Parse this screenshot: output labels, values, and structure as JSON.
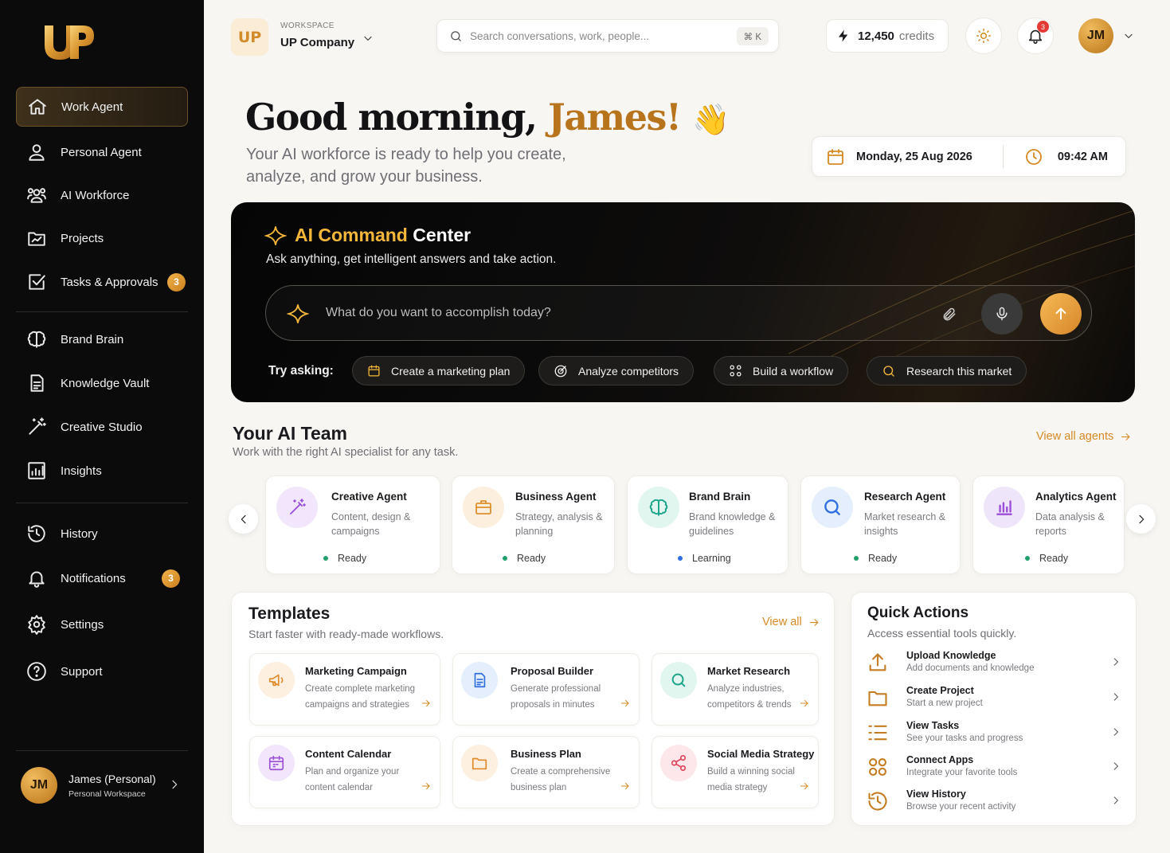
{
  "sidebar": {
    "logo_text": "UP",
    "items": [
      {
        "label": "Work Agent"
      },
      {
        "label": "Personal Agent"
      },
      {
        "label": "AI Workforce"
      },
      {
        "label": "Projects"
      },
      {
        "label": "Tasks & Approvals",
        "badge": "3"
      },
      {
        "label": "Brand Brain"
      },
      {
        "label": "Knowledge Vault"
      },
      {
        "label": "Creative Studio"
      },
      {
        "label": "Insights"
      },
      {
        "label": "History"
      },
      {
        "label": "Notifications",
        "badge": "3"
      },
      {
        "label": "Settings"
      },
      {
        "label": "Support"
      }
    ],
    "user": {
      "initials": "JM",
      "name": "James (Personal)",
      "workspace": "Personal Workspace"
    }
  },
  "header": {
    "workspace_logo": "UP",
    "workspace_label": "WORKSPACE",
    "workspace_name": "UP Company",
    "search_placeholder": "Search conversations, work, people...",
    "search_shortcut": "⌘ K",
    "credits_value": "12,450",
    "credits_label": "credits",
    "notification_count": "3",
    "avatar_initials": "JM"
  },
  "greeting": {
    "prefix": "Good morning, ",
    "name": "James!",
    "emoji": "👋",
    "subtitle": "Your AI workforce is ready to help you create, analyze, and grow your business.",
    "date": "Monday, 25 Aug 2026",
    "time": "09:42 AM"
  },
  "command_center": {
    "title_accent": "AI Command",
    "title_rest": " Center",
    "subtitle": "Ask anything, get intelligent answers and take action.",
    "input_placeholder": "What do you want to accomplish today?",
    "try_label": "Try asking:",
    "suggestions": [
      "Create a marketing plan",
      "Analyze competitors",
      "Build a workflow",
      "Research this market"
    ]
  },
  "ai_team": {
    "title": "Your AI Team",
    "subtitle": "Work with the right AI specialist for any task.",
    "view_all": "View all agents",
    "agents": [
      {
        "name": "Creative Agent",
        "desc": "Content, design & campaigns",
        "status": "Ready",
        "status_color": "#22a06b"
      },
      {
        "name": "Business Agent",
        "desc": "Strategy, analysis & planning",
        "status": "Ready",
        "status_color": "#22a06b"
      },
      {
        "name": "Brand Brain",
        "desc": "Brand knowledge & guidelines",
        "status": "Learning",
        "status_color": "#2f6fe0"
      },
      {
        "name": "Research Agent",
        "desc": "Market research & insights",
        "status": "Ready",
        "status_color": "#22a06b"
      },
      {
        "name": "Analytics Agent",
        "desc": "Data analysis & reports",
        "status": "Ready",
        "status_color": "#22a06b"
      }
    ]
  },
  "templates": {
    "title": "Templates",
    "subtitle": "Start faster with ready-made workflows.",
    "view_all": "View all",
    "items": [
      {
        "name": "Marketing Campaign",
        "desc": "Create complete marketing campaigns and strategies"
      },
      {
        "name": "Proposal Builder",
        "desc": "Generate professional proposals in minutes"
      },
      {
        "name": "Market Research",
        "desc": "Analyze industries, competitors & trends"
      },
      {
        "name": "Content Calendar",
        "desc": "Plan and organize your content calendar"
      },
      {
        "name": "Business Plan",
        "desc": "Create a comprehensive business plan"
      },
      {
        "name": "Social Media Strategy",
        "desc": "Build a winning social media strategy"
      }
    ]
  },
  "quick_actions": {
    "title": "Quick Actions",
    "subtitle": "Access essential tools quickly.",
    "items": [
      {
        "name": "Upload Knowledge",
        "desc": "Add documents and knowledge"
      },
      {
        "name": "Create Project",
        "desc": "Start a new project"
      },
      {
        "name": "View Tasks",
        "desc": "See your tasks and progress"
      },
      {
        "name": "Connect Apps",
        "desc": "Integrate your favorite tools"
      },
      {
        "name": "View History",
        "desc": "Browse your recent activity"
      }
    ]
  },
  "colors": {
    "accent": "#d58a24",
    "gold": "#f5b73a",
    "sidebar_bg": "#0b0b0c",
    "ready": "#22a06b",
    "learning": "#2f6fe0"
  }
}
